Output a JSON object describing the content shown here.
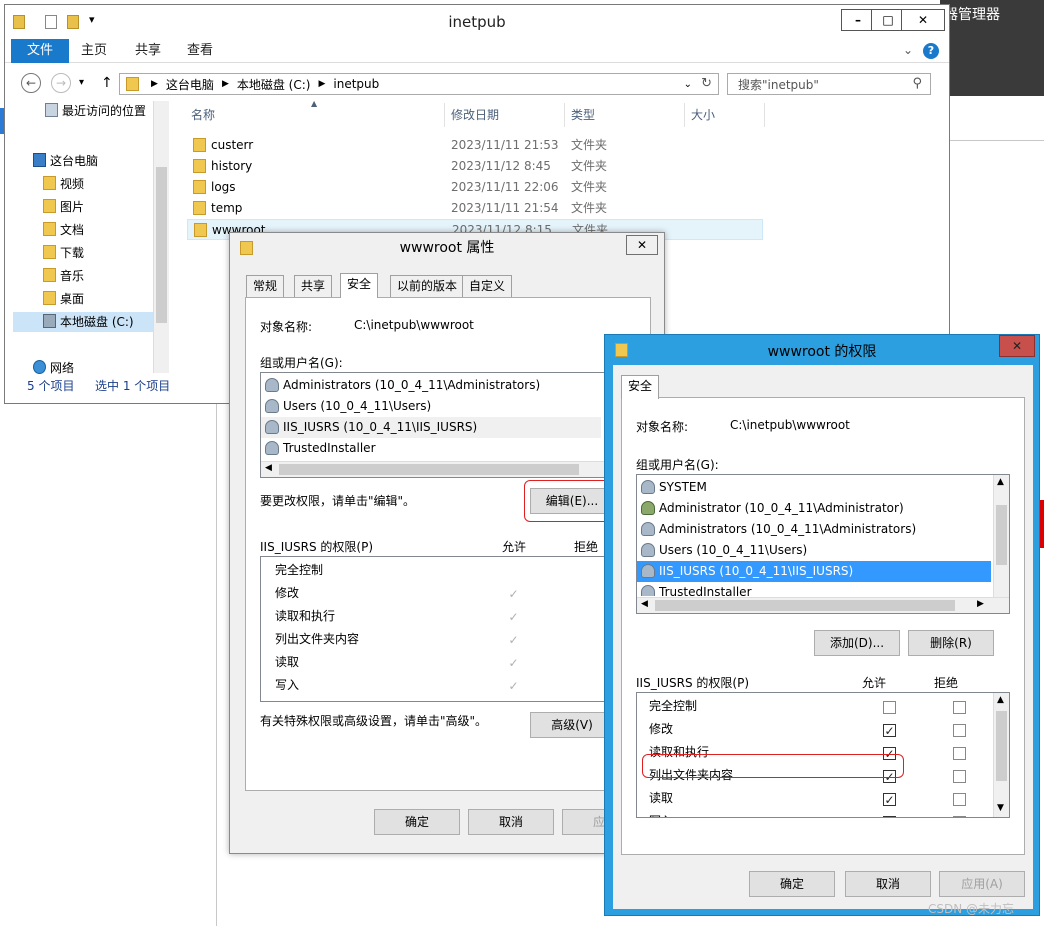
{
  "background": {
    "right_title": "器管理器",
    "watermark": "CSDN @未力忘"
  },
  "explorer": {
    "title": "inetpub",
    "ribbon_tabs": [
      "文件",
      "主页",
      "共享",
      "查看"
    ],
    "address": [
      "这台电脑",
      "本地磁盘 (C:)",
      "inetpub"
    ],
    "search_placeholder": "搜索\"inetpub\"",
    "nav": {
      "recent": "最近访问的位置",
      "this_pc": "这台电脑",
      "items": [
        "视频",
        "图片",
        "文档",
        "下载",
        "音乐",
        "桌面",
        "本地磁盘 (C:)"
      ],
      "network": "网络"
    },
    "status": {
      "count": "5 个项目",
      "selected": "选中 1 个项目"
    },
    "columns": [
      "名称",
      "修改日期",
      "类型",
      "大小"
    ],
    "files": [
      {
        "name": "custerr",
        "date": "2023/11/11 21:53",
        "type": "文件夹"
      },
      {
        "name": "history",
        "date": "2023/11/12 8:45",
        "type": "文件夹"
      },
      {
        "name": "logs",
        "date": "2023/11/11 22:06",
        "type": "文件夹"
      },
      {
        "name": "temp",
        "date": "2023/11/11 21:54",
        "type": "文件夹"
      },
      {
        "name": "wwwroot",
        "date": "2023/11/12 8:15",
        "type": "文件夹"
      }
    ]
  },
  "properties": {
    "title": "wwwroot 属性",
    "tabs": [
      "常规",
      "共享",
      "安全",
      "以前的版本",
      "自定义"
    ],
    "object_label": "对象名称:",
    "object_value": "C:\\inetpub\\wwwroot",
    "group_label": "组或用户名(G):",
    "users": [
      "Administrators (10_0_4_11\\Administrators)",
      "Users (10_0_4_11\\Users)",
      "IIS_IUSRS (10_0_4_11\\IIS_IUSRS)",
      "TrustedInstaller"
    ],
    "edit_hint": "要更改权限，请单击\"编辑\"。",
    "edit_button": "编辑(E)...",
    "perm_label": "IIS_IUSRS 的权限(P)",
    "allow_label": "允许",
    "deny_label": "拒绝",
    "permissions": [
      {
        "name": "完全控制",
        "allow": false
      },
      {
        "name": "修改",
        "allow": true
      },
      {
        "name": "读取和执行",
        "allow": true
      },
      {
        "name": "列出文件夹内容",
        "allow": true
      },
      {
        "name": "读取",
        "allow": true
      },
      {
        "name": "写入",
        "allow": true
      }
    ],
    "advanced_hint": "有关特殊权限或高级设置，请单击\"高级\"。",
    "advanced_button": "高级(V)",
    "ok": "确定",
    "cancel": "取消",
    "apply": "应用"
  },
  "permissions_dialog": {
    "title": "wwwroot 的权限",
    "tab": "安全",
    "object_label": "对象名称:",
    "object_value": "C:\\inetpub\\wwwroot",
    "group_label": "组或用户名(G):",
    "users": [
      "SYSTEM",
      "Administrator (10_0_4_11\\Administrator)",
      "Administrators (10_0_4_11\\Administrators)",
      "Users (10_0_4_11\\Users)",
      "IIS_IUSRS (10_0_4_11\\IIS_IUSRS)",
      "TrustedInstaller"
    ],
    "selected_user_index": 4,
    "add_button": "添加(D)...",
    "remove_button": "删除(R)",
    "perm_label": "IIS_IUSRS 的权限(P)",
    "allow_label": "允许",
    "deny_label": "拒绝",
    "permissions": [
      {
        "name": "完全控制",
        "allow": false,
        "deny": false
      },
      {
        "name": "修改",
        "allow": true,
        "deny": false
      },
      {
        "name": "读取和执行",
        "allow": true,
        "deny": false
      },
      {
        "name": "列出文件夹内容",
        "allow": true,
        "deny": false
      },
      {
        "name": "读取",
        "allow": true,
        "deny": false
      },
      {
        "name": "写入",
        "allow": true,
        "deny": false
      }
    ],
    "ok": "确定",
    "cancel": "取消",
    "apply": "应用(A)"
  }
}
